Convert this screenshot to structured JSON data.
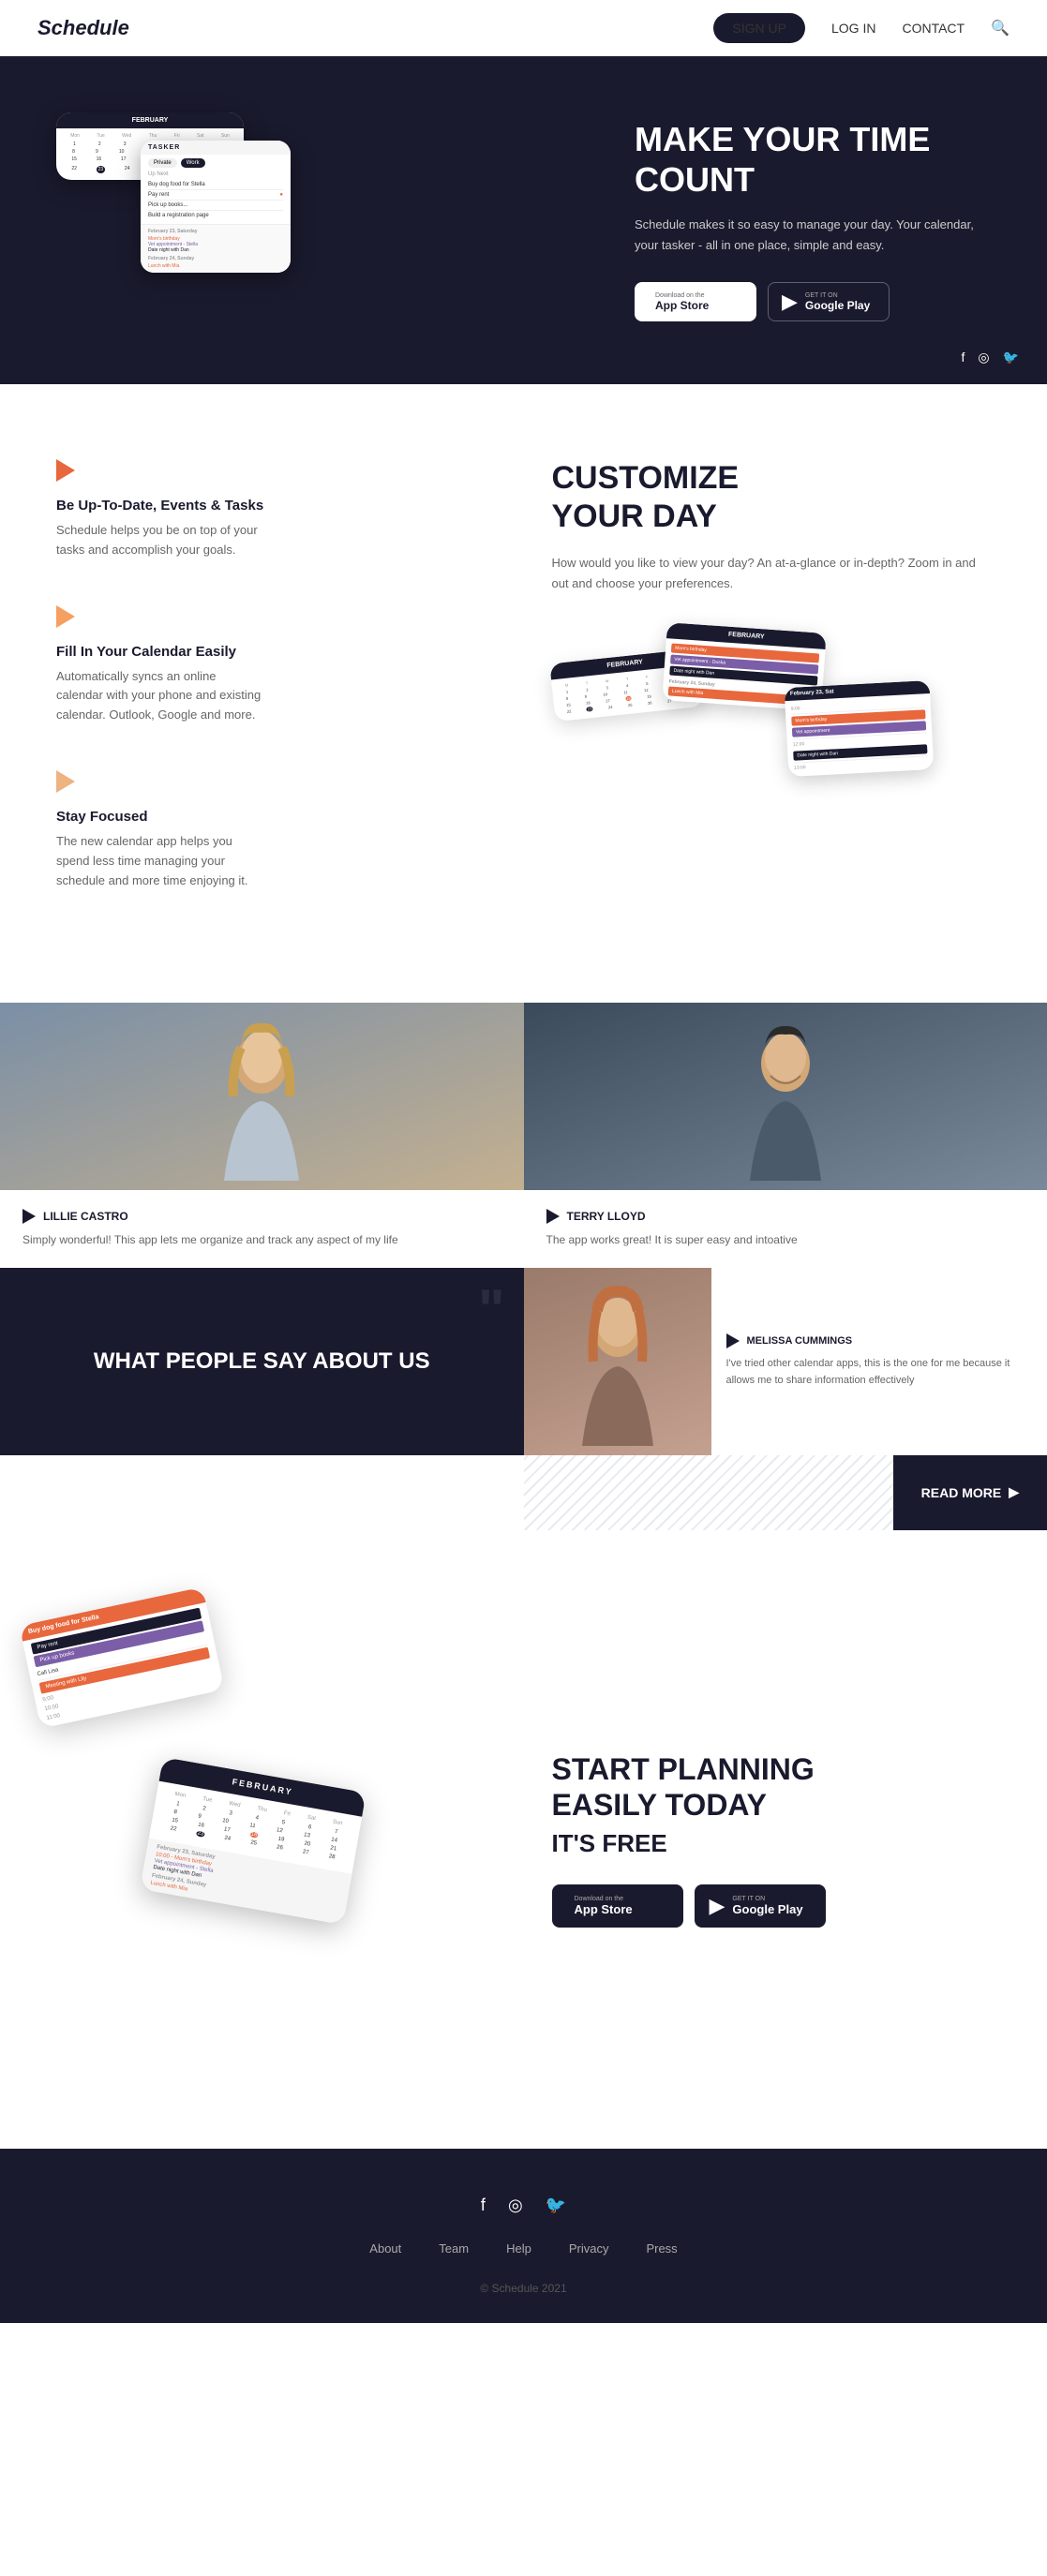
{
  "nav": {
    "logo": "Schedule",
    "signup": "SIGN UP",
    "login": "LOG IN",
    "contact": "CONTACT"
  },
  "hero": {
    "title_part1": "MAKE YOUR TIME ",
    "title_part2": "COUNT",
    "subtitle": "Schedule makes it so easy to manage your day. Your calendar, your tasker - all in one place, simple and easy.",
    "phone_month": "FEBRUARY",
    "app_store_label": "Download on the",
    "app_store_name": "App Store",
    "google_play_label": "GET IT ON",
    "google_play_name": "Google Play",
    "task_items": [
      "Buy dog food for Stella",
      "Pay rent",
      "Pick up books from the book store",
      "Build registration page"
    ]
  },
  "features": {
    "customize_title": "CUSTOMIZE\nYOUR DAY",
    "customize_desc": "How would you like to view your day? An at-a-glance or in-depth? Zoom in and out and choose your preferences.",
    "items": [
      {
        "title": "Be Up-To-Date, Events & Tasks",
        "desc": "Schedule helps you be on top of your tasks and accomplish your goals."
      },
      {
        "title": "Fill In Your Calendar Easily",
        "desc": "Automatically syncs an online calendar with your phone and existing calendar. Outlook, Google and more."
      },
      {
        "title": "Stay Focused",
        "desc": "The new calendar app helps you spend less time managing your schedule and more time enjoying it."
      }
    ]
  },
  "testimonials": {
    "section_title": "WHAT PEOPLE SAY ABOUT US",
    "read_more": "READ MORE",
    "people": [
      {
        "name": "LILLIE CASTRO",
        "text": "Simply wonderful! This app lets me organize and track any aspect of my life"
      },
      {
        "name": "TERRY LLOYD",
        "text": "The app works great! It is super easy and intoative"
      },
      {
        "name": "MELISSA CUMMINGS",
        "text": "I've tried other calendar apps, this is the one for me because it allows me to share information effectively"
      }
    ]
  },
  "cta": {
    "title_line1": "START PLANNING",
    "title_line2": "EASILY TODAY",
    "free_label": "IT'S FREE",
    "app_store_label": "Download on the",
    "app_store_name": "App Store",
    "google_play_label": "GET IT ON",
    "google_play_name": "Google Play",
    "phone_month": "FEBRUARY"
  },
  "footer": {
    "links": [
      "About",
      "Team",
      "Help",
      "Privacy",
      "Press"
    ],
    "copyright": "© Schedule 2021"
  }
}
